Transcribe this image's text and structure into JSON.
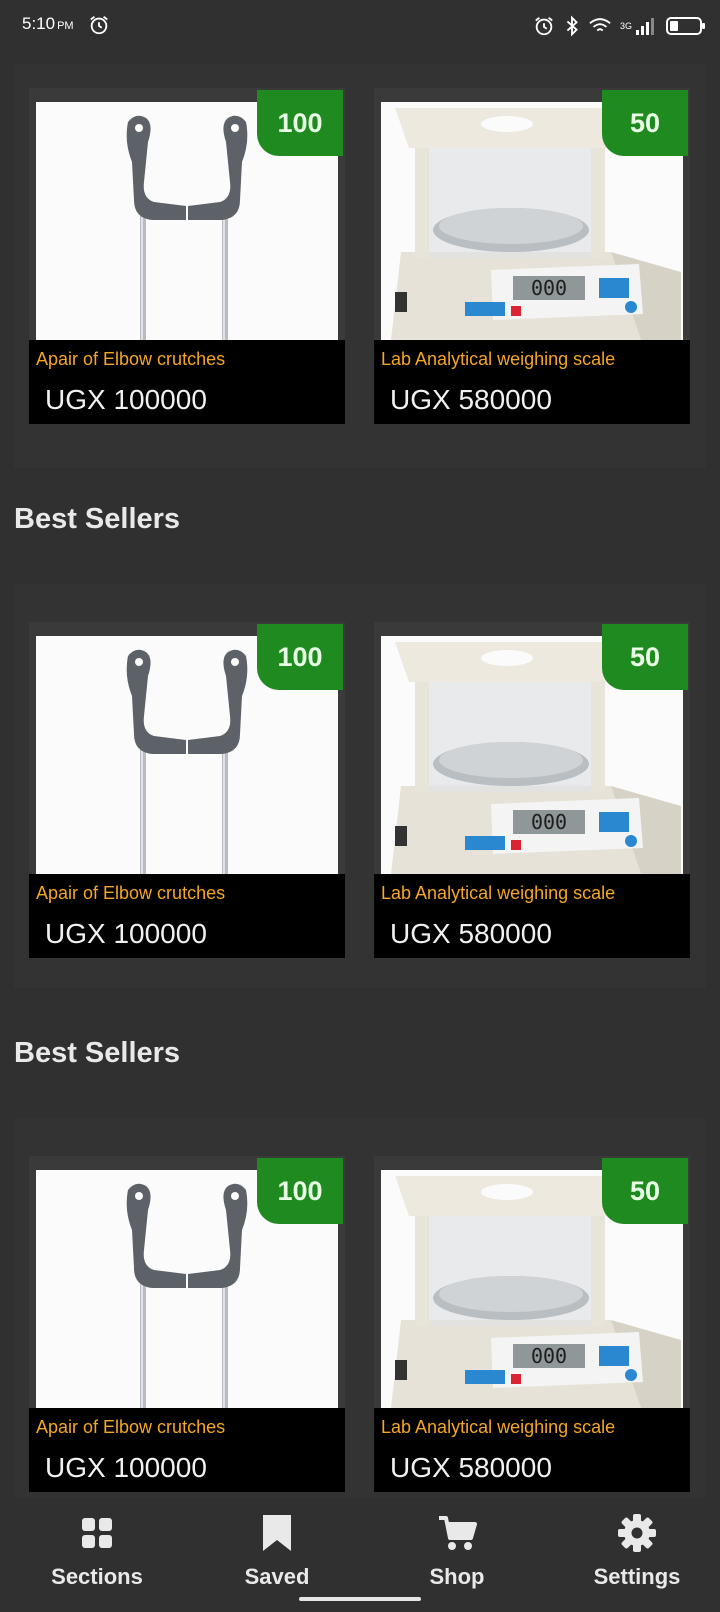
{
  "status_bar": {
    "time": "5:10",
    "ampm": "PM",
    "network": "3G",
    "icons": [
      "alarm-icon",
      "bluetooth-icon",
      "wifi-icon",
      "signal-icon",
      "battery-icon"
    ]
  },
  "sections": [
    {
      "title": "",
      "products": [
        {
          "name": "Apair of Elbow crutches",
          "price": "UGX 100000",
          "badge": "100",
          "image": "crutches"
        },
        {
          "name": "Lab Analytical weighing scale",
          "price": "UGX 580000",
          "badge": "50",
          "image": "scale"
        }
      ]
    },
    {
      "title": "Best Sellers",
      "products": [
        {
          "name": "Apair of Elbow crutches",
          "price": "UGX 100000",
          "badge": "100",
          "image": "crutches"
        },
        {
          "name": "Lab Analytical weighing scale",
          "price": "UGX 580000",
          "badge": "50",
          "image": "scale"
        }
      ]
    },
    {
      "title": "Best Sellers",
      "products": [
        {
          "name": "Apair of Elbow crutches",
          "price": "UGX 100000",
          "badge": "100",
          "image": "crutches"
        },
        {
          "name": "Lab Analytical weighing scale",
          "price": "UGX 580000",
          "badge": "50",
          "image": "scale"
        }
      ]
    }
  ],
  "bottom_nav": [
    {
      "label": "Sections",
      "icon": "grid-icon"
    },
    {
      "label": "Saved",
      "icon": "bookmark-icon"
    },
    {
      "label": "Shop",
      "icon": "cart-icon"
    },
    {
      "label": "Settings",
      "icon": "gear-icon"
    }
  ],
  "colors": {
    "background": "#303030",
    "badge": "#1f8a1f",
    "product_name": "#f5a623",
    "price_bar": "#000000"
  }
}
